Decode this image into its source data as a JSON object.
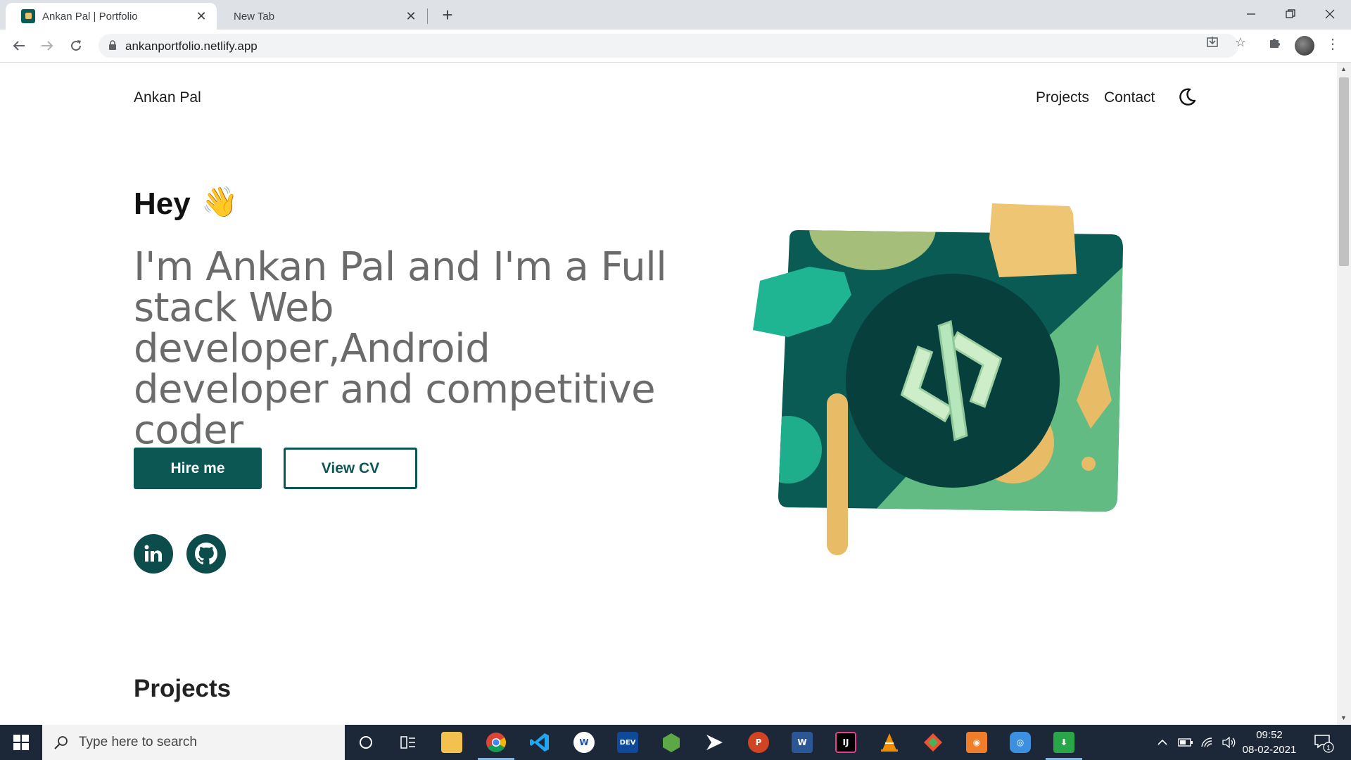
{
  "browser": {
    "tabs": [
      {
        "title": "Ankan Pal | Portfolio",
        "active": true
      },
      {
        "title": "New Tab",
        "active": false
      }
    ],
    "url": "ankanportfolio.netlify.app"
  },
  "site": {
    "brand": "Ankan Pal",
    "nav": [
      "Projects",
      "Contact"
    ],
    "greeting": "Hey",
    "greeting_emoji": "👋",
    "intro": "I'm Ankan Pal and I'm a Full stack Web developer,Android developer and competitive coder",
    "hire_label": "Hire me",
    "cv_label": "View CV",
    "social": [
      "linkedin-icon",
      "github-icon"
    ],
    "projects_heading": "Projects",
    "colors": {
      "primary": "#0c5754",
      "text_muted": "#6b6b6b"
    }
  },
  "taskbar": {
    "search_placeholder": "Type here to search",
    "apps": [
      "cortana",
      "task-view",
      "file-explorer",
      "chrome",
      "vscode",
      "wps",
      "devcpp",
      "nodejs",
      "terminal",
      "powerpoint",
      "word",
      "intellij",
      "vlc",
      "git",
      "photo",
      "screen-recorder",
      "download-manager"
    ],
    "time": "09:52",
    "date": "08-02-2021",
    "notification_count": "1"
  }
}
